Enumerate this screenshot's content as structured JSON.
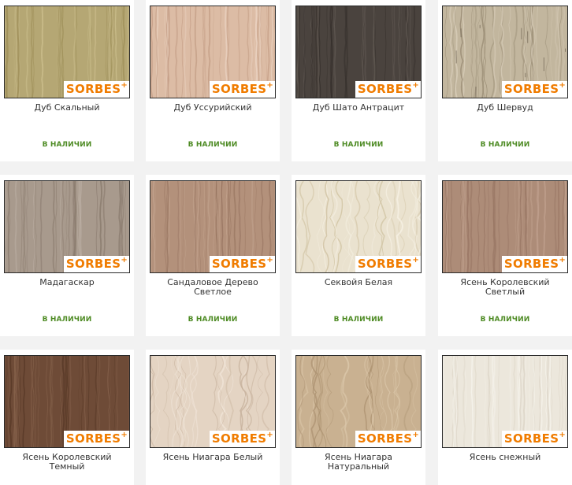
{
  "brand_logo_text": "SORBES",
  "brand_logo_mark": "+",
  "colors": {
    "logo": "#f07c00",
    "in_stock": "#4e8b24"
  },
  "products": [
    {
      "name": "Дуб Скальный",
      "stock": "В НАЛИЧИИ",
      "swatch": {
        "base": "#b5a774",
        "grain": "#9c8d57",
        "light": "#cabd8c",
        "style": "straight"
      }
    },
    {
      "name": "Дуб Уссурийский",
      "stock": "В НАЛИЧИИ",
      "swatch": {
        "base": "#dcbca5",
        "grain": "#c49e86",
        "light": "#ead3c2",
        "style": "straight"
      }
    },
    {
      "name": "Дуб Шато Антрацит",
      "stock": "В НАЛИЧИИ",
      "swatch": {
        "base": "#4a433e",
        "grain": "#332d29",
        "light": "#625a54",
        "style": "straight"
      }
    },
    {
      "name": "Дуб Шервуд",
      "stock": "В НАЛИЧИИ",
      "swatch": {
        "base": "#c2b69e",
        "grain": "#978a72",
        "light": "#d7ccb8",
        "style": "rustic"
      }
    },
    {
      "name": "Мадагаскар",
      "stock": "В НАЛИЧИИ",
      "swatch": {
        "base": "#a89a8d",
        "grain": "#8a7b6e",
        "light": "#c2b6ab",
        "style": "straight"
      }
    },
    {
      "name": "Сандаловое Дерево Светлое",
      "stock": "В НАЛИЧИИ",
      "swatch": {
        "base": "#b3917b",
        "grain": "#9a7763",
        "light": "#c7a994",
        "style": "straight"
      }
    },
    {
      "name": "Секвойя Белая",
      "stock": "В НАЛИЧИИ",
      "swatch": {
        "base": "#eae2cf",
        "grain": "#cdbf9d",
        "light": "#f6f1e4",
        "style": "flame"
      }
    },
    {
      "name": "Ясень Королевский Светлый",
      "stock": "В НАЛИЧИИ",
      "swatch": {
        "base": "#ad8c78",
        "grain": "#957361",
        "light": "#c2a390",
        "style": "straight"
      }
    },
    {
      "name": "Ясень Королевский Темный",
      "stock": "",
      "swatch": {
        "base": "#6e4b37",
        "grain": "#573826",
        "light": "#86624c",
        "style": "straight"
      }
    },
    {
      "name": "Ясень Ниагара Белый",
      "stock": "",
      "swatch": {
        "base": "#e4d4c3",
        "grain": "#c8b39e",
        "light": "#f1e6da",
        "style": "flame"
      }
    },
    {
      "name": "Ясень Ниагара Натуральный",
      "stock": "",
      "swatch": {
        "base": "#c9b191",
        "grain": "#a98f6e",
        "light": "#dcc8ab",
        "style": "flame"
      }
    },
    {
      "name": "Ясень снежный",
      "stock": "",
      "swatch": {
        "base": "#ece7dc",
        "grain": "#d8d0c1",
        "light": "#f6f3ec",
        "style": "straight"
      }
    }
  ]
}
